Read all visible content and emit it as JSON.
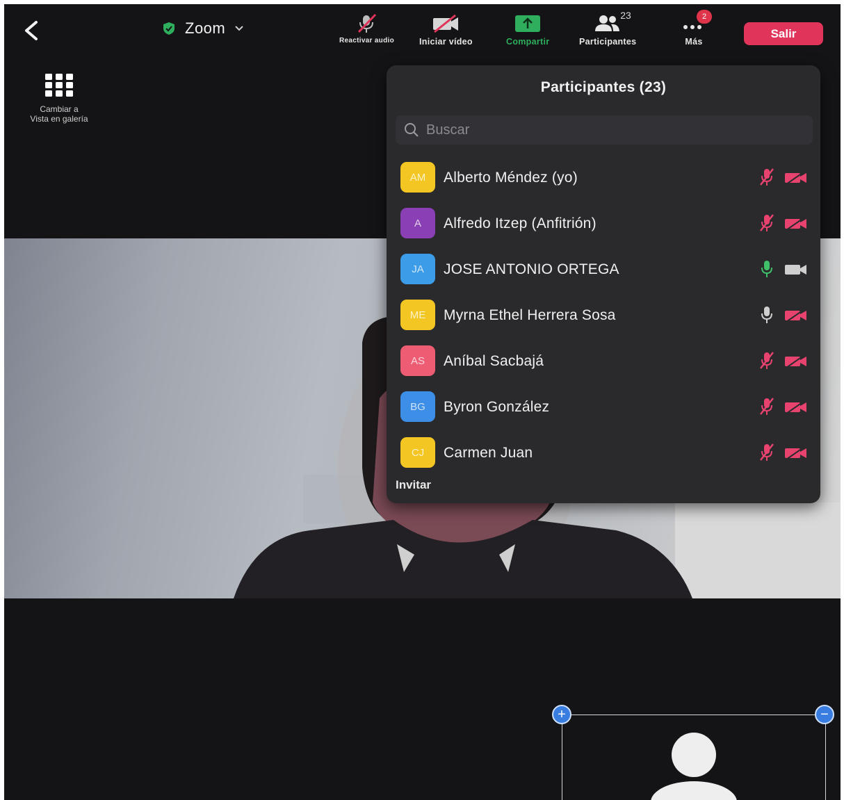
{
  "header": {
    "meeting_title": "Zoom",
    "toolbar": {
      "audio_label": "Reactivar audio",
      "video_label": "Iniciar vídeo",
      "share_label": "Compartir",
      "participants_label": "Participantes",
      "participants_count": "23",
      "more_label": "Más",
      "more_badge": "2"
    },
    "leave_label": "Salir"
  },
  "gallery": {
    "label_line1": "Cambiar a",
    "label_line2": "Vista en galería"
  },
  "panel": {
    "title": "Participantes (23)",
    "search_placeholder": "Buscar",
    "participants": [
      {
        "initials": "AM",
        "name": "Alberto Méndez (yo)",
        "color": "#f3c623",
        "mic": "muted",
        "video": "off"
      },
      {
        "initials": "A",
        "name": "Alfredo Itzep (Anfitrión)",
        "color": "#8a3fb5",
        "mic": "muted",
        "video": "off"
      },
      {
        "initials": "JA",
        "name": "JOSE ANTONIO ORTEGA",
        "color": "#3d9ce8",
        "mic": "on",
        "video": "on"
      },
      {
        "initials": "ME",
        "name": "Myrna Ethel Herrera Sosa",
        "color": "#f3c623",
        "mic": "on",
        "video": "off"
      },
      {
        "initials": "AS",
        "name": "Aníbal Sacbajá",
        "color": "#ee5c74",
        "mic": "muted",
        "video": "off"
      },
      {
        "initials": "BG",
        "name": "Byron González",
        "color": "#3d8ee6",
        "mic": "muted",
        "video": "off"
      },
      {
        "initials": "CJ",
        "name": "Carmen Juan",
        "color": "#f3c623",
        "mic": "muted",
        "video": "off"
      }
    ],
    "invite_label": "Invitar"
  },
  "colors": {
    "accent_red": "#e0345a",
    "share_green": "#2fae5d",
    "muted_pink": "#e8426f",
    "bg": "#141416",
    "panel_bg": "#2a2a2d"
  }
}
